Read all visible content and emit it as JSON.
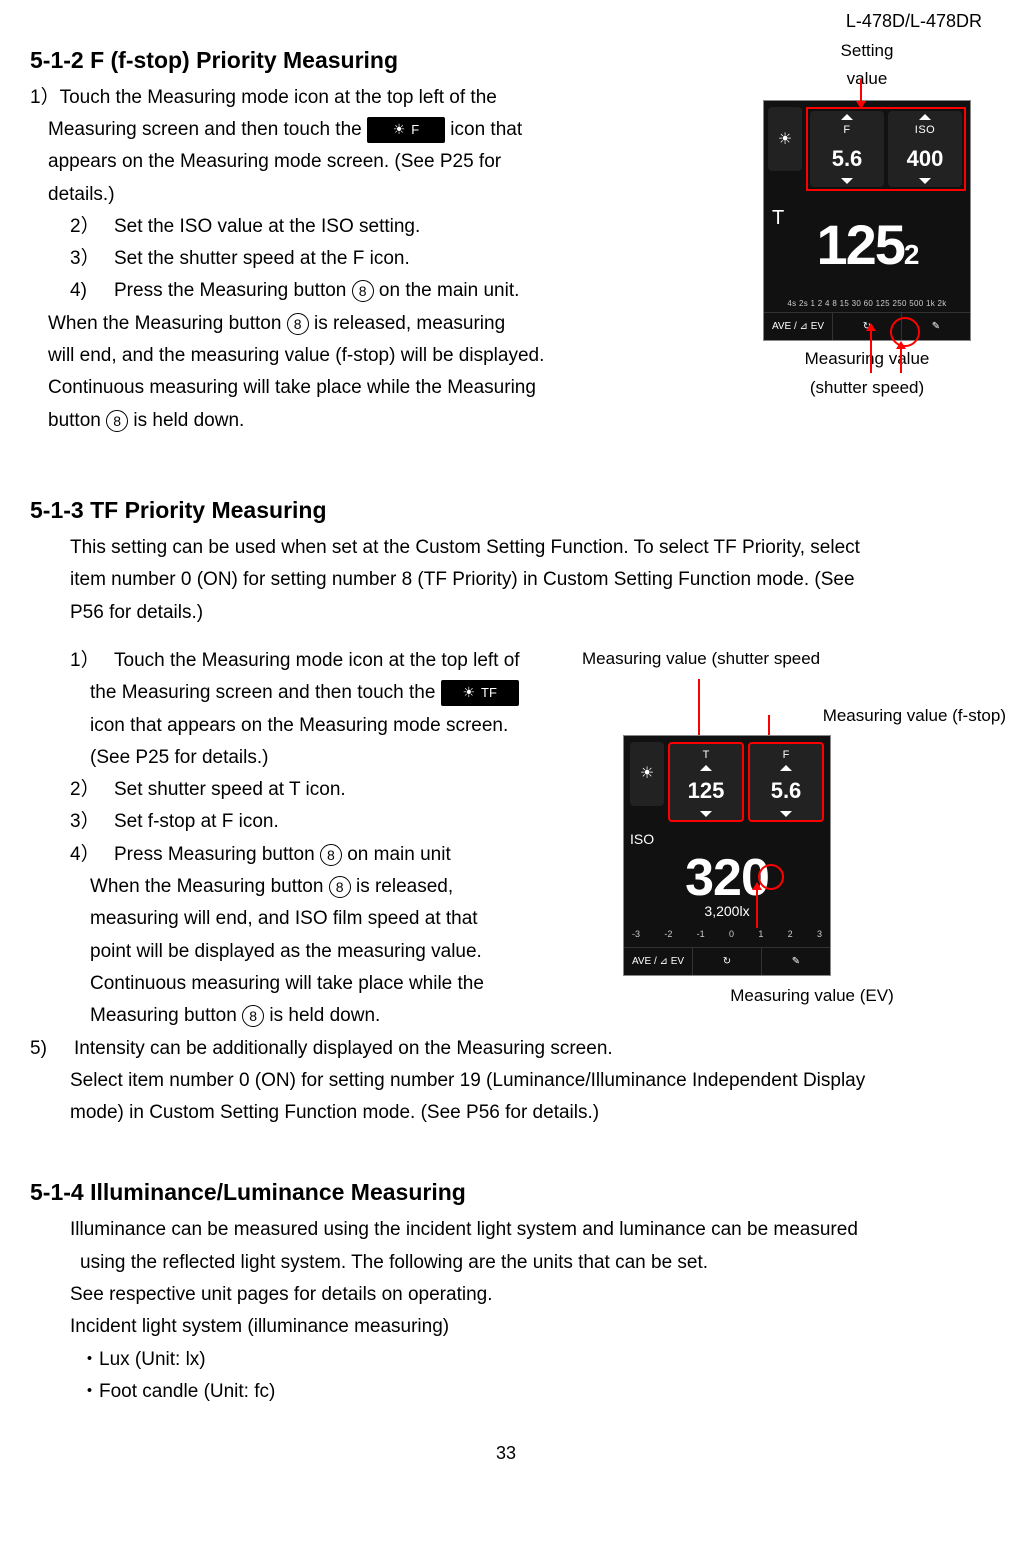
{
  "header": {
    "model": "L-478D/L-478DR"
  },
  "section512": {
    "title": "5-1-2 F (f-stop) Priority Measuring",
    "intro1_a": "1）Touch the Measuring mode icon at the top left of the",
    "intro1_b": "Measuring screen and then touch the",
    "intro1_c": "icon that",
    "intro1_d": "appears on the Measuring mode screen. (See P25 for",
    "intro1_e": "details.)",
    "icon_label": "F",
    "step2": "Set the ISO value at the ISO setting.",
    "step3": "Set the shutter speed at the F icon.",
    "step4_a": "Press the Measuring button",
    "step4_b": "on the main unit.",
    "tail_a": "When the Measuring button",
    "tail_b": "is released, measuring",
    "tail_c": "will end, and the measuring value (f-stop) will be displayed.",
    "tail_d": "Continuous measuring will take place while the Measuring",
    "tail_e": "button",
    "tail_f": "is held down.",
    "num2": "2）",
    "num3": "3）",
    "num4": "4)",
    "eight": "8",
    "fig": {
      "setting_label_a": "Setting",
      "setting_label_b": "value",
      "meas_label_a": "Measuring value",
      "meas_label_b": "(shutter speed)",
      "F_lbl": "F",
      "ISO_lbl": "ISO",
      "F_val": "5.6",
      "ISO_val": "400",
      "T": "T",
      "big": "125",
      "big_sub": "2",
      "scale": "4s 2s 1 2 4 8 15 30 60 125 250 500 1k 2k",
      "ave": "AVE / ⊿ EV",
      "refresh": "↻",
      "wrench": "✎"
    }
  },
  "section513": {
    "title": "5-1-3 TF Priority Measuring",
    "para_a": "This setting can be used when set at the Custom Setting Function. To select TF Priority, select",
    "para_b": "item number 0 (ON) for setting number 8 (TF Priority) in Custom Setting Function mode. (See",
    "para_c": "P56 for details.)",
    "step1_a": "Touch the Measuring mode icon at the top left of",
    "step1_b": "the Measuring screen and then touch the",
    "step1_c": "icon that appears on the Measuring mode screen.",
    "step1_d": "(See P25 for details.)",
    "icon_label": "TF",
    "step2": "Set shutter speed at T icon.",
    "step3": "Set f-stop at F icon.",
    "step4_a": "Press Measuring button",
    "step4_b": "on main unit",
    "step4_c": "When the Measuring button",
    "step4_d": "is released,",
    "step4_e": "measuring will end, and ISO film speed at that",
    "step4_f": "point will be displayed as the measuring value.",
    "step4_g": "Continuous measuring will take place while the",
    "step4_h": "Measuring button",
    "step4_i": "is held down.",
    "num1": "1）",
    "num2": "2）",
    "num3": "3）",
    "num4": "4）",
    "num5": "5)",
    "eight": "8",
    "step5_a": "Intensity can be additionally displayed on the Measuring screen.",
    "step5_b": "Select item number 0 (ON) for setting number 19 (Luminance/Illuminance Independent Display",
    "step5_c": "mode) in Custom Setting Function mode. (See P56 for details.)",
    "fig": {
      "top_ss": "Measuring value (shutter speed",
      "top_f": "Measuring value (f-stop)",
      "bottom_ev": "Measuring value (EV)",
      "T_lbl": "T",
      "F_lbl": "F",
      "T_val": "125",
      "F_val": "5.6",
      "ISO_lbl": "ISO",
      "ISO_big": "320",
      "ISO_small": "3,200lx",
      "ev_m3": "-3",
      "ev_m2": "-2",
      "ev_m1": "-1",
      "ev_0": "0",
      "ev_1": "1",
      "ev_2": "2",
      "ev_3": "3",
      "ave": "AVE / ⊿ EV",
      "refresh": "↻",
      "wrench": "✎"
    }
  },
  "section514": {
    "title": "5-1-4 Illuminance/Luminance Measuring",
    "p1": "Illuminance can be measured using the incident light system and luminance can be measured",
    "p2": "using the reflected light system. The following are the units that can be set.",
    "p3": "See respective unit pages for details on operating.",
    "p4": "Incident light system (illuminance measuring)",
    "p5": "・Lux (Unit: lx)",
    "p6": "・Foot candle (Unit: fc)"
  },
  "page_number": "33"
}
